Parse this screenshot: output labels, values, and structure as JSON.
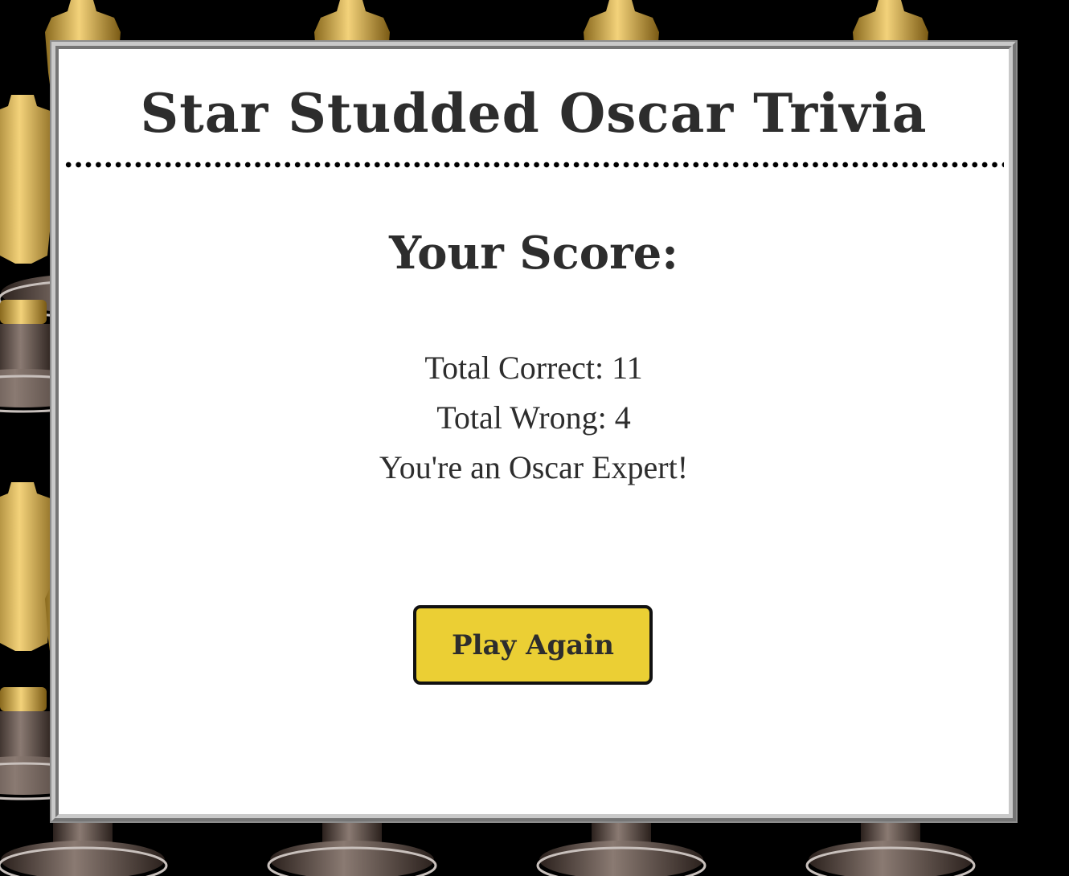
{
  "header": {
    "title": "Star Studded Oscar Trivia"
  },
  "score": {
    "heading": "Your Score:",
    "correct_line": "Total Correct: 11",
    "wrong_line": "Total Wrong: 4",
    "rating": "You're an Oscar Expert!"
  },
  "actions": {
    "play_again_label": "Play Again"
  },
  "background": {
    "pattern": "oscar-statuette-icon",
    "color": "#000000"
  },
  "colors": {
    "button": "#ebcf34",
    "text": "#2d2d2d"
  }
}
